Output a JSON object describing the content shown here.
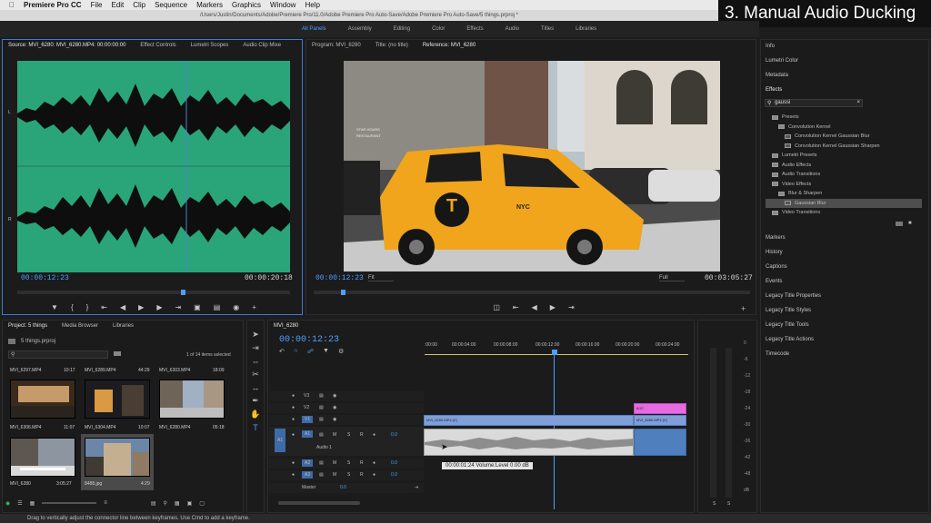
{
  "menubar": {
    "app": "Premiere Pro CC",
    "items": [
      "File",
      "Edit",
      "Clip",
      "Sequence",
      "Markers",
      "Graphics",
      "Window",
      "Help"
    ]
  },
  "titlebar": {
    "path": "/Users/Justin/Documents/Adobe/Premiere Pro/11.0/Adobe Premiere Pro Auto-Save/Adobe Premiere Pro Auto-Save/5 things.prproj *"
  },
  "overlay": {
    "title": "3. Manual Audio Ducking"
  },
  "workspaces": [
    "All Panels",
    "Assembly",
    "Editing",
    "Color",
    "Effects",
    "Audio",
    "Titles",
    "Libraries"
  ],
  "source": {
    "tabs": [
      "Source: MVI_6280: MVI_6280.MP4: 00:00:00:00",
      "Effect Controls",
      "Lumetri Scopes",
      "Audio Clip Mixe"
    ],
    "timecode": "00:00:12:23",
    "duration": "00:00:20:18",
    "ch": [
      "L",
      "R"
    ]
  },
  "program": {
    "tabs": [
      "Program: MVI_6280",
      "Title: (no title)",
      "Reference: MVI_6280"
    ],
    "timecode": "00:00:12:23",
    "fit": "Fit",
    "quality": "Full",
    "duration": "00:03:05:27"
  },
  "taxi": {
    "logo": "T",
    "sign": "NYC",
    "shop": "STAR HOURS",
    "street": "RESTAURANT"
  },
  "project": {
    "tabs": [
      "Project: 5 things",
      "Media Browser",
      "Libraries"
    ],
    "file": "5 things.prproj",
    "count": "1 of 14 items selected",
    "items": [
      {
        "name": "MVI_6297.MP4",
        "dur": "10:17"
      },
      {
        "name": "MVI_6289.MP4",
        "dur": "44:29"
      },
      {
        "name": "MVI_6303.MP4",
        "dur": "18:09"
      },
      {
        "name": "MVI_6306.MP4",
        "dur": "11:07"
      },
      {
        "name": "MVI_6304.MP4",
        "dur": "10:07"
      },
      {
        "name": "MVI_6280.MP4",
        "dur": "05:18"
      },
      {
        "name": "MVI_6280",
        "dur": "3:05:27"
      },
      {
        "name": "8488.jpg",
        "dur": "4:29"
      }
    ]
  },
  "timeline": {
    "tab": "MVI_6280",
    "timecode": "00:00:12:23",
    "ruler": [
      ":00:00",
      "00:00:04:00",
      "00:00:08:00",
      "00:00:12:00",
      "00:00:16:00",
      "00:00:20:00",
      "00:00:24:00"
    ],
    "tracks": {
      "v3": "V3",
      "v2": "V2",
      "v1": "V1",
      "a1": "A1",
      "a1name": "Audio 1",
      "a2": "A2",
      "a3": "A3",
      "master": "Master",
      "m": "M",
      "s": "S",
      "r": "R",
      "vol": "0.0"
    },
    "clips": {
      "v1a": "MVI_6280.MP4 [V]",
      "v1b": "MVI_6280.MP4 [V]",
      "v2": "8/JC",
      "tooltip": "00:00:01:24  Volume:Level  0.00 dB"
    }
  },
  "meter": {
    "labels": [
      "0",
      "-6",
      "-12",
      "-18",
      "-24",
      "-30",
      "-36",
      "-42",
      "-48",
      "dB"
    ],
    "solo": "S"
  },
  "right": {
    "top": [
      "Info",
      "Lumetri Color",
      "Metadata"
    ],
    "effects_title": "Effects",
    "search": "gaussi",
    "tree": [
      {
        "label": "Presets",
        "indent": 1,
        "folder": true
      },
      {
        "label": "Convolution Kernel",
        "indent": 2,
        "folder": true
      },
      {
        "label": "Convolution Kernel Gaussian Blur",
        "indent": 3,
        "folder": false
      },
      {
        "label": "Convolution Kernel Gaussian Sharpen",
        "indent": 3,
        "folder": false
      },
      {
        "label": "Lumetri Presets",
        "indent": 1,
        "folder": true
      },
      {
        "label": "Audio Effects",
        "indent": 1,
        "folder": true
      },
      {
        "label": "Audio Transitions",
        "indent": 1,
        "folder": true
      },
      {
        "label": "Video Effects",
        "indent": 1,
        "folder": true
      },
      {
        "label": "Blur & Sharpen",
        "indent": 2,
        "folder": true
      },
      {
        "label": "Gaussian Blur",
        "indent": 3,
        "folder": false,
        "selected": true
      },
      {
        "label": "Video Transitions",
        "indent": 1,
        "folder": true
      }
    ],
    "bottom": [
      "Markers",
      "History",
      "Captions",
      "Events",
      "Legacy Title Properties",
      "Legacy Title Styles",
      "Legacy Title Tools",
      "Legacy Title Actions",
      "Timecode"
    ]
  },
  "status": {
    "text": "Drag to vertically adjust the connector line between keyframes. Use Cmd to add a keyframe."
  },
  "colors": {
    "accent": "#4aa0ff",
    "waveform_bg": "#2aa57a",
    "clip_video": "#7e9fd8",
    "clip_audio": "#4f7fbd",
    "clip_pink": "#e66ae0"
  }
}
